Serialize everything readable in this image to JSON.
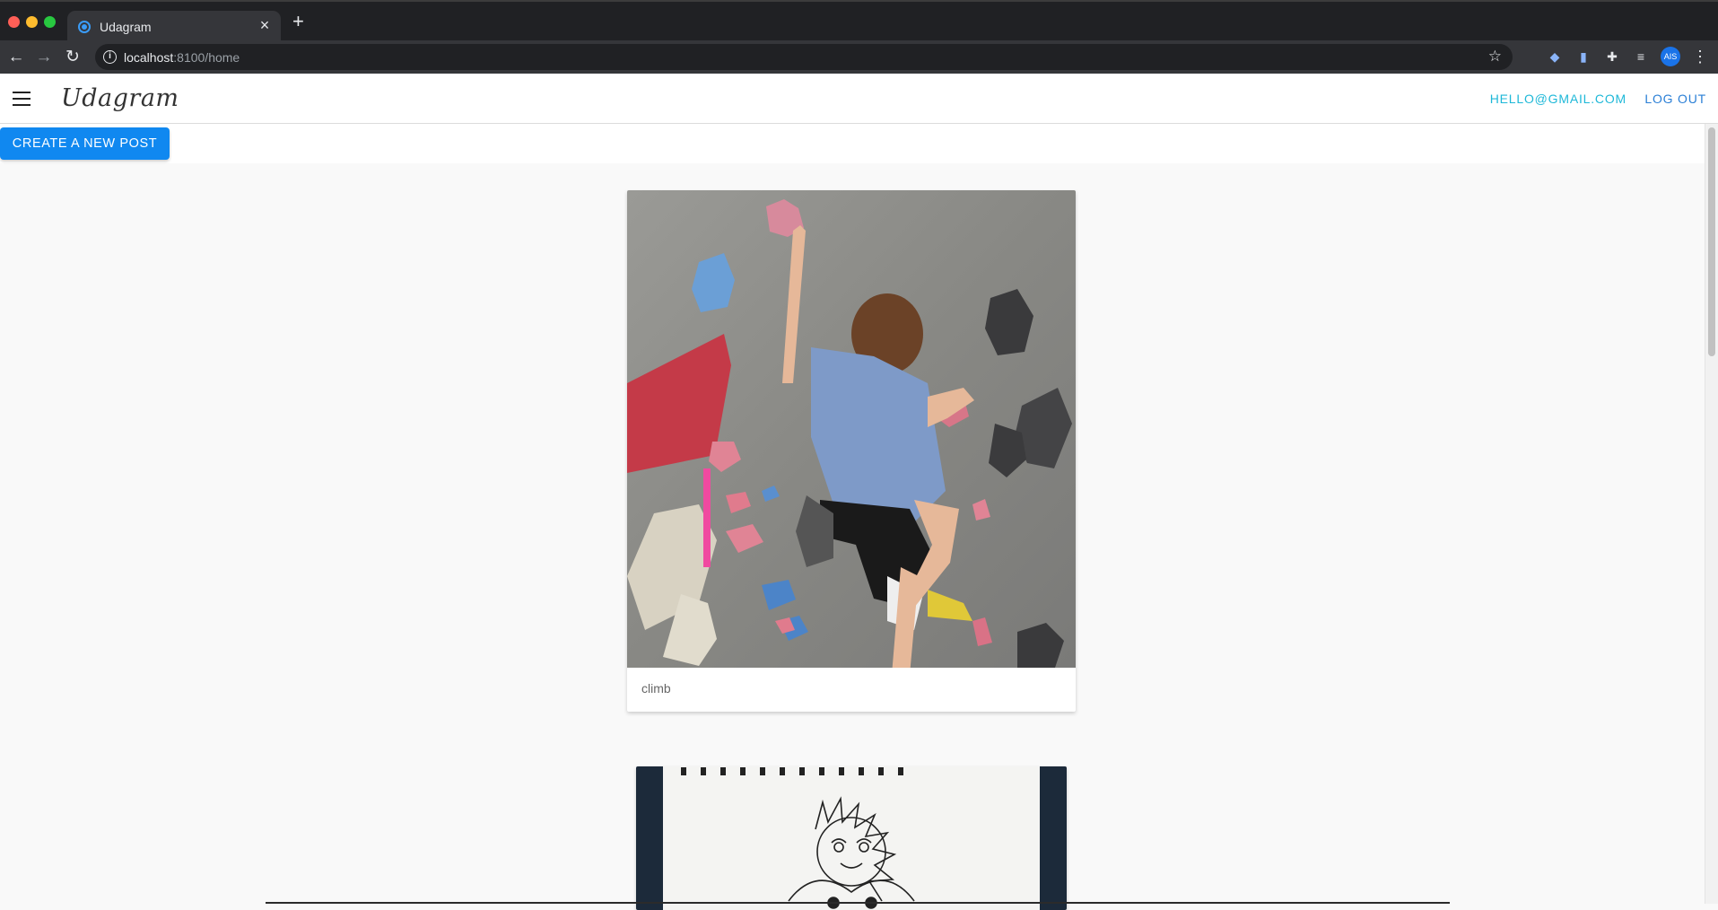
{
  "browser": {
    "tab_title": "Udagram",
    "tab_close": "×",
    "new_tab": "+",
    "url_host": "localhost",
    "url_rest": ":8100/home",
    "back": "←",
    "forward": "→",
    "reload": "↻",
    "info": "i",
    "star": "☆",
    "profile_initials": "AIS",
    "menu": "⋮"
  },
  "app": {
    "brand": "Udagram",
    "user_email": "HELLO@GMAIL.COM",
    "logout_label": "LOG OUT",
    "create_post_label": "CREATE A NEW POST",
    "colors": {
      "accent": "#1088f0",
      "email_link": "#1eb8d8",
      "logout_link": "#2a7fd6"
    }
  },
  "feed": {
    "posts": [
      {
        "caption": "climb",
        "image": "photo of a child climbing a bouldering wall"
      },
      {
        "caption": "",
        "image": "ink drawing of a sun on a sketchbook page"
      }
    ]
  }
}
